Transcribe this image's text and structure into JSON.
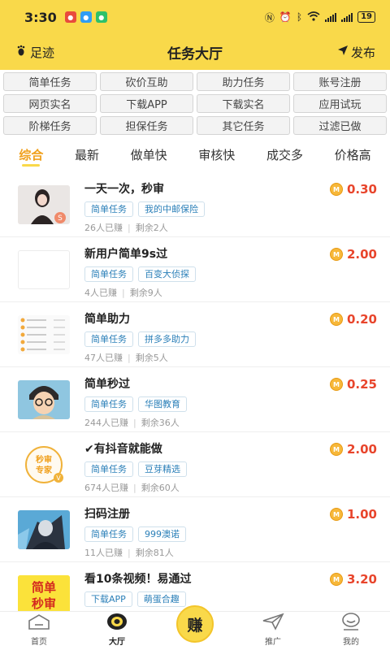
{
  "status_bar": {
    "time": "3:30",
    "battery": "19",
    "notifications": [
      {
        "icon": "notification-app-icon",
        "color": "#e94b3c"
      },
      {
        "icon": "message-icon",
        "color": "#2f9df4"
      },
      {
        "icon": "chat-bubble-icon",
        "color": "#2ec16a"
      }
    ]
  },
  "header": {
    "left_label": "足迹",
    "title": "任务大厅",
    "right_label": "发布"
  },
  "categories": [
    "简单任务",
    "砍价互助",
    "助力任务",
    "账号注册",
    "网页实名",
    "下载APP",
    "下载实名",
    "应用试玩",
    "阶梯任务",
    "担保任务",
    "其它任务",
    "过滤已做"
  ],
  "sort_tabs": [
    {
      "label": "综合",
      "active": true
    },
    {
      "label": "最新",
      "active": false
    },
    {
      "label": "做单快",
      "active": false
    },
    {
      "label": "审核快",
      "active": false
    },
    {
      "label": "成交多",
      "active": false
    },
    {
      "label": "价格高",
      "active": false
    }
  ],
  "tasks": [
    {
      "title": "一天一次，秒审",
      "tags": [
        "简单任务",
        "我的中邮保险"
      ],
      "done": "26人已赚",
      "remaining": "剩余2人",
      "reward": "0.30",
      "thumb": "portrait-photo",
      "badge": "S"
    },
    {
      "title": "新用户简单9s过",
      "tags": [
        "简单任务",
        "百变大侦探"
      ],
      "done": "4人已赚",
      "remaining": "剩余9人",
      "reward": "2.00",
      "thumb": "blank"
    },
    {
      "title": "简单助力",
      "tags": [
        "简单任务",
        "拼多多助力"
      ],
      "done": "47人已赚",
      "remaining": "剩余5人",
      "reward": "0.20",
      "thumb": "list-screenshot"
    },
    {
      "title": "简单秒过",
      "tags": [
        "简单任务",
        "华图教育"
      ],
      "done": "244人已赚",
      "remaining": "剩余36人",
      "reward": "0.25",
      "thumb": "cartoon-boy"
    },
    {
      "title": "✔有抖音就能做",
      "tags": [
        "简单任务",
        "豆芽精选"
      ],
      "done": "674人已赚",
      "remaining": "剩余60人",
      "reward": "2.00",
      "thumb": "stamp-logo",
      "thumb_text": "秒审专家",
      "badge": "V"
    },
    {
      "title": "扫码注册",
      "tags": [
        "简单任务",
        "999澳诺"
      ],
      "done": "11人已赚",
      "remaining": "剩余81人",
      "reward": "1.00",
      "thumb": "anime-art"
    },
    {
      "title": "看10条视频！易通过",
      "tags": [
        "下载APP",
        "萌蛋合趣"
      ],
      "done": "",
      "remaining": "",
      "reward": "3.20",
      "thumb": "text-logo",
      "thumb_text": "简单秒审"
    }
  ],
  "coin_label": "M",
  "bottom_nav": [
    {
      "label": "首页",
      "icon": "home-icon",
      "active": false
    },
    {
      "label": "大厅",
      "icon": "hall-icon",
      "active": true
    },
    {
      "label": "",
      "center_text": "赚",
      "icon": "earn-icon"
    },
    {
      "label": "推广",
      "icon": "send-icon",
      "active": false
    },
    {
      "label": "我的",
      "icon": "profile-icon",
      "active": false
    }
  ],
  "colors": {
    "brand_yellow": "#f9d94a",
    "accent_orange": "#f0a01c",
    "price_red": "#e8452c",
    "tag_blue": "#2a7fb8"
  }
}
